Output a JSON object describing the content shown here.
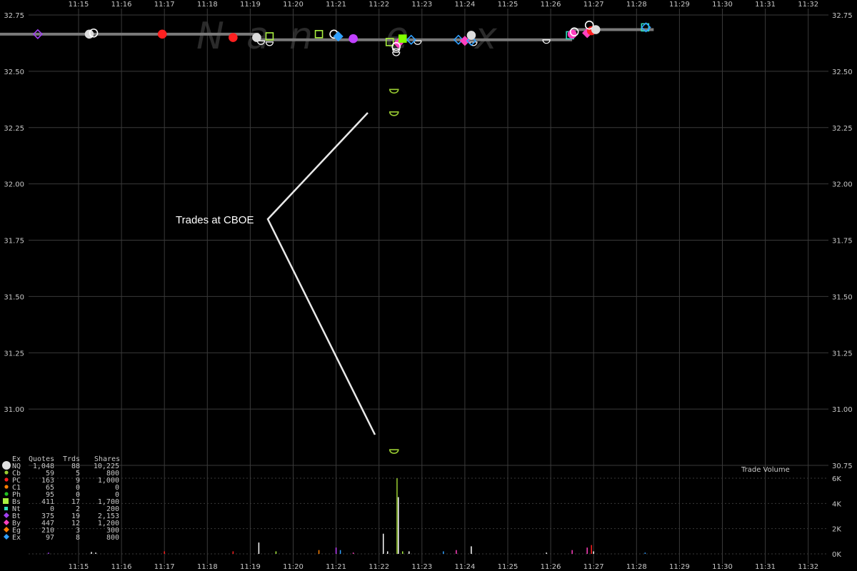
{
  "chart_data": {
    "type": "scatter",
    "title": "",
    "x_ticks": [
      "11:15",
      "11:16",
      "11:17",
      "11:18",
      "11:19",
      "11:20",
      "11:21",
      "11:22",
      "11:23",
      "11:24",
      "11:25",
      "11:26",
      "11:27",
      "11:28",
      "11:29",
      "11:30",
      "11:31",
      "11:32"
    ],
    "y_ticks": [
      "32.75",
      "32.50",
      "32.25",
      "32.00",
      "31.75",
      "31.50",
      "31.25",
      "31.00",
      "30.75"
    ],
    "ylim": [
      30.75,
      32.75
    ],
    "watermark": [
      "N",
      "a",
      "n",
      "e",
      "x"
    ],
    "volume_title": "Trade Volume",
    "volume_ticks": [
      "6K",
      "4K",
      "2K",
      "0K"
    ],
    "volume_ylim": [
      0,
      6000
    ],
    "annotation": "Trades at CBOE",
    "nbbo_segments": [
      {
        "x0": 11.0,
        "x1": 19.2,
        "y": 32.665
      },
      {
        "x0": 19.2,
        "x1": 26.5,
        "y": 32.64
      },
      {
        "x0": 26.5,
        "x1": 28.4,
        "y": 32.685
      }
    ],
    "trades": [
      {
        "t": 14.05,
        "p": 32.665,
        "ex": "Bt",
        "shape": "diamond",
        "color": "#a040f0",
        "fill": false
      },
      {
        "t": 15.25,
        "p": 32.665,
        "ex": "NQ",
        "shape": "circle",
        "color": "#dcdcdc",
        "fill": true
      },
      {
        "t": 15.35,
        "p": 32.67,
        "ex": "NQ",
        "shape": "circle",
        "color": "#ffffff",
        "fill": false
      },
      {
        "t": 16.95,
        "p": 32.665,
        "ex": "PC",
        "shape": "circle",
        "color": "#ff2020",
        "fill": true
      },
      {
        "t": 18.6,
        "p": 32.65,
        "ex": "PC",
        "shape": "circle",
        "color": "#ff2020",
        "fill": true
      },
      {
        "t": 19.15,
        "p": 32.65,
        "ex": "NQ",
        "shape": "circle",
        "color": "#dcdcdc",
        "fill": true
      },
      {
        "t": 19.45,
        "p": 32.655,
        "ex": "Bs",
        "shape": "square",
        "color": "#aaf040",
        "fill": false
      },
      {
        "t": 20.6,
        "p": 32.665,
        "ex": "Bs",
        "shape": "square",
        "color": "#aaf040",
        "fill": false
      },
      {
        "t": 20.95,
        "p": 32.665,
        "ex": "NQ",
        "shape": "circle",
        "color": "#ffffff",
        "fill": false
      },
      {
        "t": 21.05,
        "p": 32.655,
        "ex": "Ex",
        "shape": "diamond",
        "color": "#30a0ff",
        "fill": true
      },
      {
        "t": 21.4,
        "p": 32.645,
        "ex": "Bt",
        "shape": "circle",
        "color": "#c040ff",
        "fill": true
      },
      {
        "t": 22.25,
        "p": 32.63,
        "ex": "Bs",
        "shape": "square",
        "color": "#aaf040",
        "fill": false
      },
      {
        "t": 22.45,
        "p": 32.625,
        "ex": "By",
        "shape": "diamond",
        "color": "#ff40c0",
        "fill": true
      },
      {
        "t": 22.55,
        "p": 32.645,
        "ex": "Bs",
        "shape": "square",
        "color": "#80ff00",
        "fill": true
      },
      {
        "t": 22.4,
        "p": 32.61,
        "ex": "NQ",
        "shape": "circle",
        "color": "#ffffff",
        "fill": false
      },
      {
        "t": 22.75,
        "p": 32.64,
        "ex": "Ex",
        "shape": "diamond",
        "color": "#30a0ff",
        "fill": false
      },
      {
        "t": 22.35,
        "p": 32.41,
        "ex": "Cb",
        "shape": "halfcircle",
        "color": "#9acd32",
        "fill": false
      },
      {
        "t": 22.35,
        "p": 32.31,
        "ex": "Cb",
        "shape": "halfcircle",
        "color": "#9acd32",
        "fill": false
      },
      {
        "t": 22.35,
        "p": 30.81,
        "ex": "Cb",
        "shape": "halfcircle",
        "color": "#9acd32",
        "fill": false
      },
      {
        "t": 23.85,
        "p": 32.64,
        "ex": "Ex",
        "shape": "diamond",
        "color": "#30a0ff",
        "fill": false
      },
      {
        "t": 24.0,
        "p": 32.635,
        "ex": "By",
        "shape": "diamond",
        "color": "#ff40c0",
        "fill": true
      },
      {
        "t": 24.15,
        "p": 32.635,
        "ex": "Ex",
        "shape": "diamond",
        "color": "#30a0ff",
        "fill": false
      },
      {
        "t": 24.15,
        "p": 32.66,
        "ex": "NQ",
        "shape": "circle",
        "color": "#dcdcdc",
        "fill": true
      },
      {
        "t": 26.45,
        "p": 32.66,
        "ex": "Nt",
        "shape": "square",
        "color": "#30e0c0",
        "fill": false
      },
      {
        "t": 26.5,
        "p": 32.665,
        "ex": "By",
        "shape": "circle",
        "color": "#ff40c0",
        "fill": true
      },
      {
        "t": 26.55,
        "p": 32.675,
        "ex": "NQ",
        "shape": "circle",
        "color": "#ffffff",
        "fill": false
      },
      {
        "t": 26.85,
        "p": 32.67,
        "ex": "By",
        "shape": "diamond",
        "color": "#ff40c0",
        "fill": true
      },
      {
        "t": 26.95,
        "p": 32.68,
        "ex": "PC",
        "shape": "circle",
        "color": "#ff2020",
        "fill": true
      },
      {
        "t": 26.9,
        "p": 32.705,
        "ex": "NQ",
        "shape": "circle",
        "color": "#ffffff",
        "fill": false
      },
      {
        "t": 27.05,
        "p": 32.685,
        "ex": "NQ",
        "shape": "circle",
        "color": "#dcdcdc",
        "fill": true
      },
      {
        "t": 28.2,
        "p": 32.695,
        "ex": "Nt",
        "shape": "square",
        "color": "#30e0c0",
        "fill": false
      },
      {
        "t": 28.22,
        "p": 32.695,
        "ex": "Ex",
        "shape": "diamond",
        "color": "#30a0ff",
        "fill": false
      }
    ],
    "quote_hollows": [
      {
        "t": 19.25,
        "p": 32.635
      },
      {
        "t": 19.45,
        "p": 32.63
      },
      {
        "t": 22.4,
        "p": 32.6
      },
      {
        "t": 22.4,
        "p": 32.585
      },
      {
        "t": 22.9,
        "p": 32.635
      },
      {
        "t": 24.2,
        "p": 32.63
      },
      {
        "t": 25.9,
        "p": 32.64
      }
    ],
    "volume": [
      {
        "t": 14.3,
        "v": 100,
        "color": "#a040f0"
      },
      {
        "t": 15.3,
        "v": 150,
        "color": "#ffffff"
      },
      {
        "t": 15.4,
        "v": 100,
        "color": "#ffffff"
      },
      {
        "t": 17.0,
        "v": 200,
        "color": "#ff2020"
      },
      {
        "t": 18.6,
        "v": 200,
        "color": "#ff2020"
      },
      {
        "t": 19.2,
        "v": 900,
        "color": "#ffffff"
      },
      {
        "t": 19.6,
        "v": 200,
        "color": "#aaf040"
      },
      {
        "t": 20.6,
        "v": 300,
        "color": "#ff8000"
      },
      {
        "t": 21.0,
        "v": 500,
        "color": "#c040ff"
      },
      {
        "t": 21.1,
        "v": 300,
        "color": "#30a0ff"
      },
      {
        "t": 21.4,
        "v": 100,
        "color": "#ff40c0"
      },
      {
        "t": 22.1,
        "v": 1600,
        "color": "#ffffff"
      },
      {
        "t": 22.2,
        "v": 200,
        "color": "#ffffff"
      },
      {
        "t": 22.42,
        "v": 6000,
        "color": "#9acd32"
      },
      {
        "t": 22.45,
        "v": 4500,
        "color": "#ffffff"
      },
      {
        "t": 22.55,
        "v": 200,
        "color": "#aaf040"
      },
      {
        "t": 22.7,
        "v": 200,
        "color": "#ffffff"
      },
      {
        "t": 23.5,
        "v": 200,
        "color": "#30a0ff"
      },
      {
        "t": 23.8,
        "v": 300,
        "color": "#ff40c0"
      },
      {
        "t": 24.15,
        "v": 600,
        "color": "#ffffff"
      },
      {
        "t": 25.9,
        "v": 100,
        "color": "#ffffff"
      },
      {
        "t": 26.5,
        "v": 300,
        "color": "#ff40c0"
      },
      {
        "t": 26.85,
        "v": 500,
        "color": "#ff40c0"
      },
      {
        "t": 26.95,
        "v": 700,
        "color": "#ff2020"
      },
      {
        "t": 27.0,
        "v": 200,
        "color": "#ffffff"
      },
      {
        "t": 28.2,
        "v": 100,
        "color": "#30a0ff"
      }
    ]
  },
  "legend": {
    "headers": [
      "Ex",
      "Quotes",
      "Trds",
      "Shares"
    ],
    "rows": [
      {
        "ex": "NQ",
        "quotes": "1,048",
        "trds": "88",
        "shares": "10,225",
        "color": "#e0e0e0",
        "shape": "circle-big"
      },
      {
        "ex": "Cb",
        "quotes": "59",
        "trds": "5",
        "shares": "800",
        "color": "#9acd32",
        "shape": "circle"
      },
      {
        "ex": "PC",
        "quotes": "163",
        "trds": "9",
        "shares": "1,000",
        "color": "#ff2020",
        "shape": "circle"
      },
      {
        "ex": "C1",
        "quotes": "65",
        "trds": "0",
        "shares": "0",
        "color": "#ff8000",
        "shape": "circle"
      },
      {
        "ex": "Ph",
        "quotes": "95",
        "trds": "0",
        "shares": "0",
        "color": "#20c020",
        "shape": "circle"
      },
      {
        "ex": "Bs",
        "quotes": "411",
        "trds": "17",
        "shares": "1,700",
        "color": "#aaf040",
        "shape": "square-big"
      },
      {
        "ex": "Nt",
        "quotes": "0",
        "trds": "2",
        "shares": "200",
        "color": "#30e0c0",
        "shape": "square"
      },
      {
        "ex": "Bt",
        "quotes": "375",
        "trds": "19",
        "shares": "2,153",
        "color": "#a040f0",
        "shape": "diamond"
      },
      {
        "ex": "By",
        "quotes": "447",
        "trds": "12",
        "shares": "1,200",
        "color": "#ff40c0",
        "shape": "diamond"
      },
      {
        "ex": "Eg",
        "quotes": "210",
        "trds": "3",
        "shares": "300",
        "color": "#ff8000",
        "shape": "diamond"
      },
      {
        "ex": "Ex",
        "quotes": "97",
        "trds": "8",
        "shares": "800",
        "color": "#30a0ff",
        "shape": "diamond"
      }
    ]
  }
}
